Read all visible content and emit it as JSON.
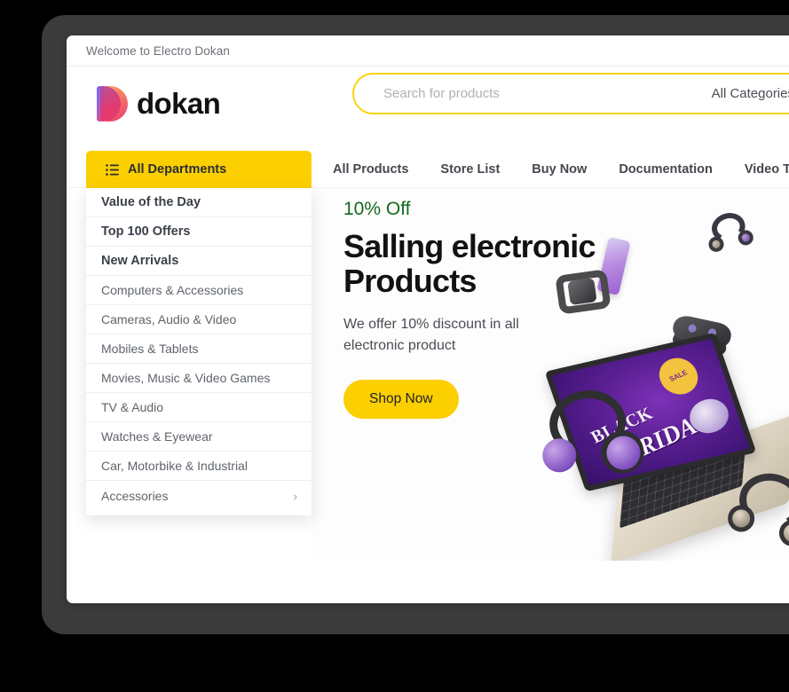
{
  "topbar": {
    "welcome_text": "Welcome to Electro Dokan",
    "account_icon": "user-icon"
  },
  "header": {
    "logo_text": "dokan",
    "logo_icon": "dokan-logo-mark",
    "search": {
      "placeholder": "Search for products",
      "value": "",
      "category_selected": "All Categories",
      "caret_icon": "updown-caret-icon",
      "border_color": "#f8d411"
    }
  },
  "nav": {
    "departments_button": {
      "label": "All Departments",
      "icon": "list-icon",
      "background": "#fccf00"
    },
    "links": [
      {
        "label": "All Products"
      },
      {
        "label": "Store List"
      },
      {
        "label": "Buy Now"
      },
      {
        "label": "Documentation"
      },
      {
        "label": "Video Tutorial"
      }
    ]
  },
  "departments_panel": {
    "items": [
      {
        "label": "Value of the Day",
        "bold": true,
        "arrow": ""
      },
      {
        "label": "Top 100 Offers",
        "bold": true,
        "arrow": ""
      },
      {
        "label": "New Arrivals",
        "bold": true,
        "arrow": ""
      },
      {
        "label": "Computers & Accessories",
        "bold": false,
        "arrow": ""
      },
      {
        "label": "Cameras, Audio & Video",
        "bold": false,
        "arrow": ""
      },
      {
        "label": "Mobiles & Tablets",
        "bold": false,
        "arrow": ""
      },
      {
        "label": "Movies, Music & Video Games",
        "bold": false,
        "arrow": ""
      },
      {
        "label": "TV & Audio",
        "bold": false,
        "arrow": ""
      },
      {
        "label": "Watches & Eyewear",
        "bold": false,
        "arrow": ""
      },
      {
        "label": "Car, Motorbike & Industrial",
        "bold": false,
        "arrow": ""
      },
      {
        "label": "Accessories",
        "bold": false,
        "arrow": "›"
      }
    ]
  },
  "hero": {
    "discount": "10% Off",
    "discount_color": "#14691f",
    "title": "Salling electronic Products",
    "subtitle": "We offer 10% discount in all electronic product",
    "cta_label": "Shop Now",
    "cta_color": "#fccf00",
    "artwork": {
      "laptop_screen_line1": "BLACK",
      "laptop_screen_line2": "FRIDAY",
      "laptop_badge": "SALE",
      "objects": [
        "headphones-icon",
        "smartphone-icon",
        "smartwatch-icon",
        "game-controller-icon",
        "laptop-icon",
        "tablet-icon",
        "remote-icon"
      ]
    }
  }
}
